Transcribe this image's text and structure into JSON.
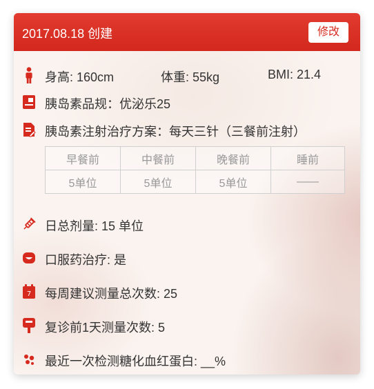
{
  "header": {
    "title": "2017.08.18 创建",
    "edit_label": "修改"
  },
  "stats": {
    "height": "身高: 160cm",
    "weight": "体重: 55kg",
    "bmi": "BMI: 21.4"
  },
  "insulin_spec": "胰岛素品规：优泌乐25",
  "insulin_plan": "胰岛素注射治疗方案：每天三针（三餐前注射）",
  "dose_table": {
    "headers": [
      "早餐前",
      "中餐前",
      "晚餐前",
      "睡前"
    ],
    "values": [
      "5单位",
      "5单位",
      "5单位",
      "——"
    ]
  },
  "daily_total": "日总剂量: 15 单位",
  "oral_med": "口服药治疗: 是",
  "weekly_tests": "每周建议测量总次数: 25",
  "pre_visit_tests": "复诊前1天测量次数: 5",
  "hba1c": "最近一次检测糖化血红蛋白: __%",
  "colors": {
    "accent": "#d72a1f",
    "text": "#333333",
    "table_text": "#999999"
  },
  "icons": [
    "person-icon",
    "insulin-pen-icon",
    "prescription-icon",
    "syringe-icon",
    "oral-medicine-icon",
    "calendar-icon",
    "glucose-meter-icon",
    "blood-drops-icon"
  ]
}
